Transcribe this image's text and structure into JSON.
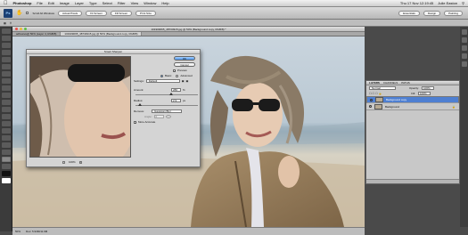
{
  "menubar": {
    "apple": "",
    "app": "Photoshop",
    "items": [
      "File",
      "Edit",
      "Image",
      "Layer",
      "Type",
      "Select",
      "Filter",
      "View",
      "Window",
      "Help"
    ],
    "clock": "Thu 17 Nov  12:19:45",
    "user": "Julie Easton"
  },
  "options": {
    "ps": "Ps",
    "buttons": [
      "Scroll All Windows",
      "Actual Pixels",
      "Fit Screen",
      "Fill Screen",
      "Print Size"
    ],
    "workspace": [
      "Essentials",
      "Design",
      "Painting"
    ]
  },
  "window": {
    "title": "101909065_48734915.jpg @ 50% (Background copy, RGB/8) *",
    "tabs": [
      "adhesive@ 50% (Layer 4, RGB/8)",
      "101909065_48734915.jpg @ 50% (Background copy, RGB/8)"
    ]
  },
  "dialog": {
    "title": "Smart Sharpen",
    "ok": "OK",
    "cancel": "Cancel",
    "preview_label": "Preview",
    "basic_label": "Basic",
    "advanced_label": "Advanced",
    "settings_label": "Settings:",
    "settings_value": "Default",
    "amount_label": "Amount:",
    "amount_value": "286",
    "amount_unit": "%",
    "amount_fraction": 0.57,
    "radius_label": "Radius:",
    "radius_value": "2.9",
    "radius_unit": "px",
    "radius_fraction": 0.05,
    "remove_label": "Remove:",
    "remove_value": "Gaussian Blur",
    "angle_label": "Angle:",
    "angle_value": "0",
    "more_accurate_label": "More Accurate",
    "zoom_level": "100%"
  },
  "layers": {
    "tabs": [
      "LAYERS",
      "CHANNELS",
      "PATHS"
    ],
    "blend_mode": "Normal",
    "opacity_label": "Opacity:",
    "opacity_value": "100%",
    "fill_label": "Fill:",
    "fill_value": "100%",
    "items": [
      {
        "name": "Background copy",
        "selected": true
      },
      {
        "name": "Background",
        "selected": false
      }
    ]
  },
  "status": {
    "zoom": "50%",
    "doc": "Doc: 5.93M/11.9M"
  }
}
